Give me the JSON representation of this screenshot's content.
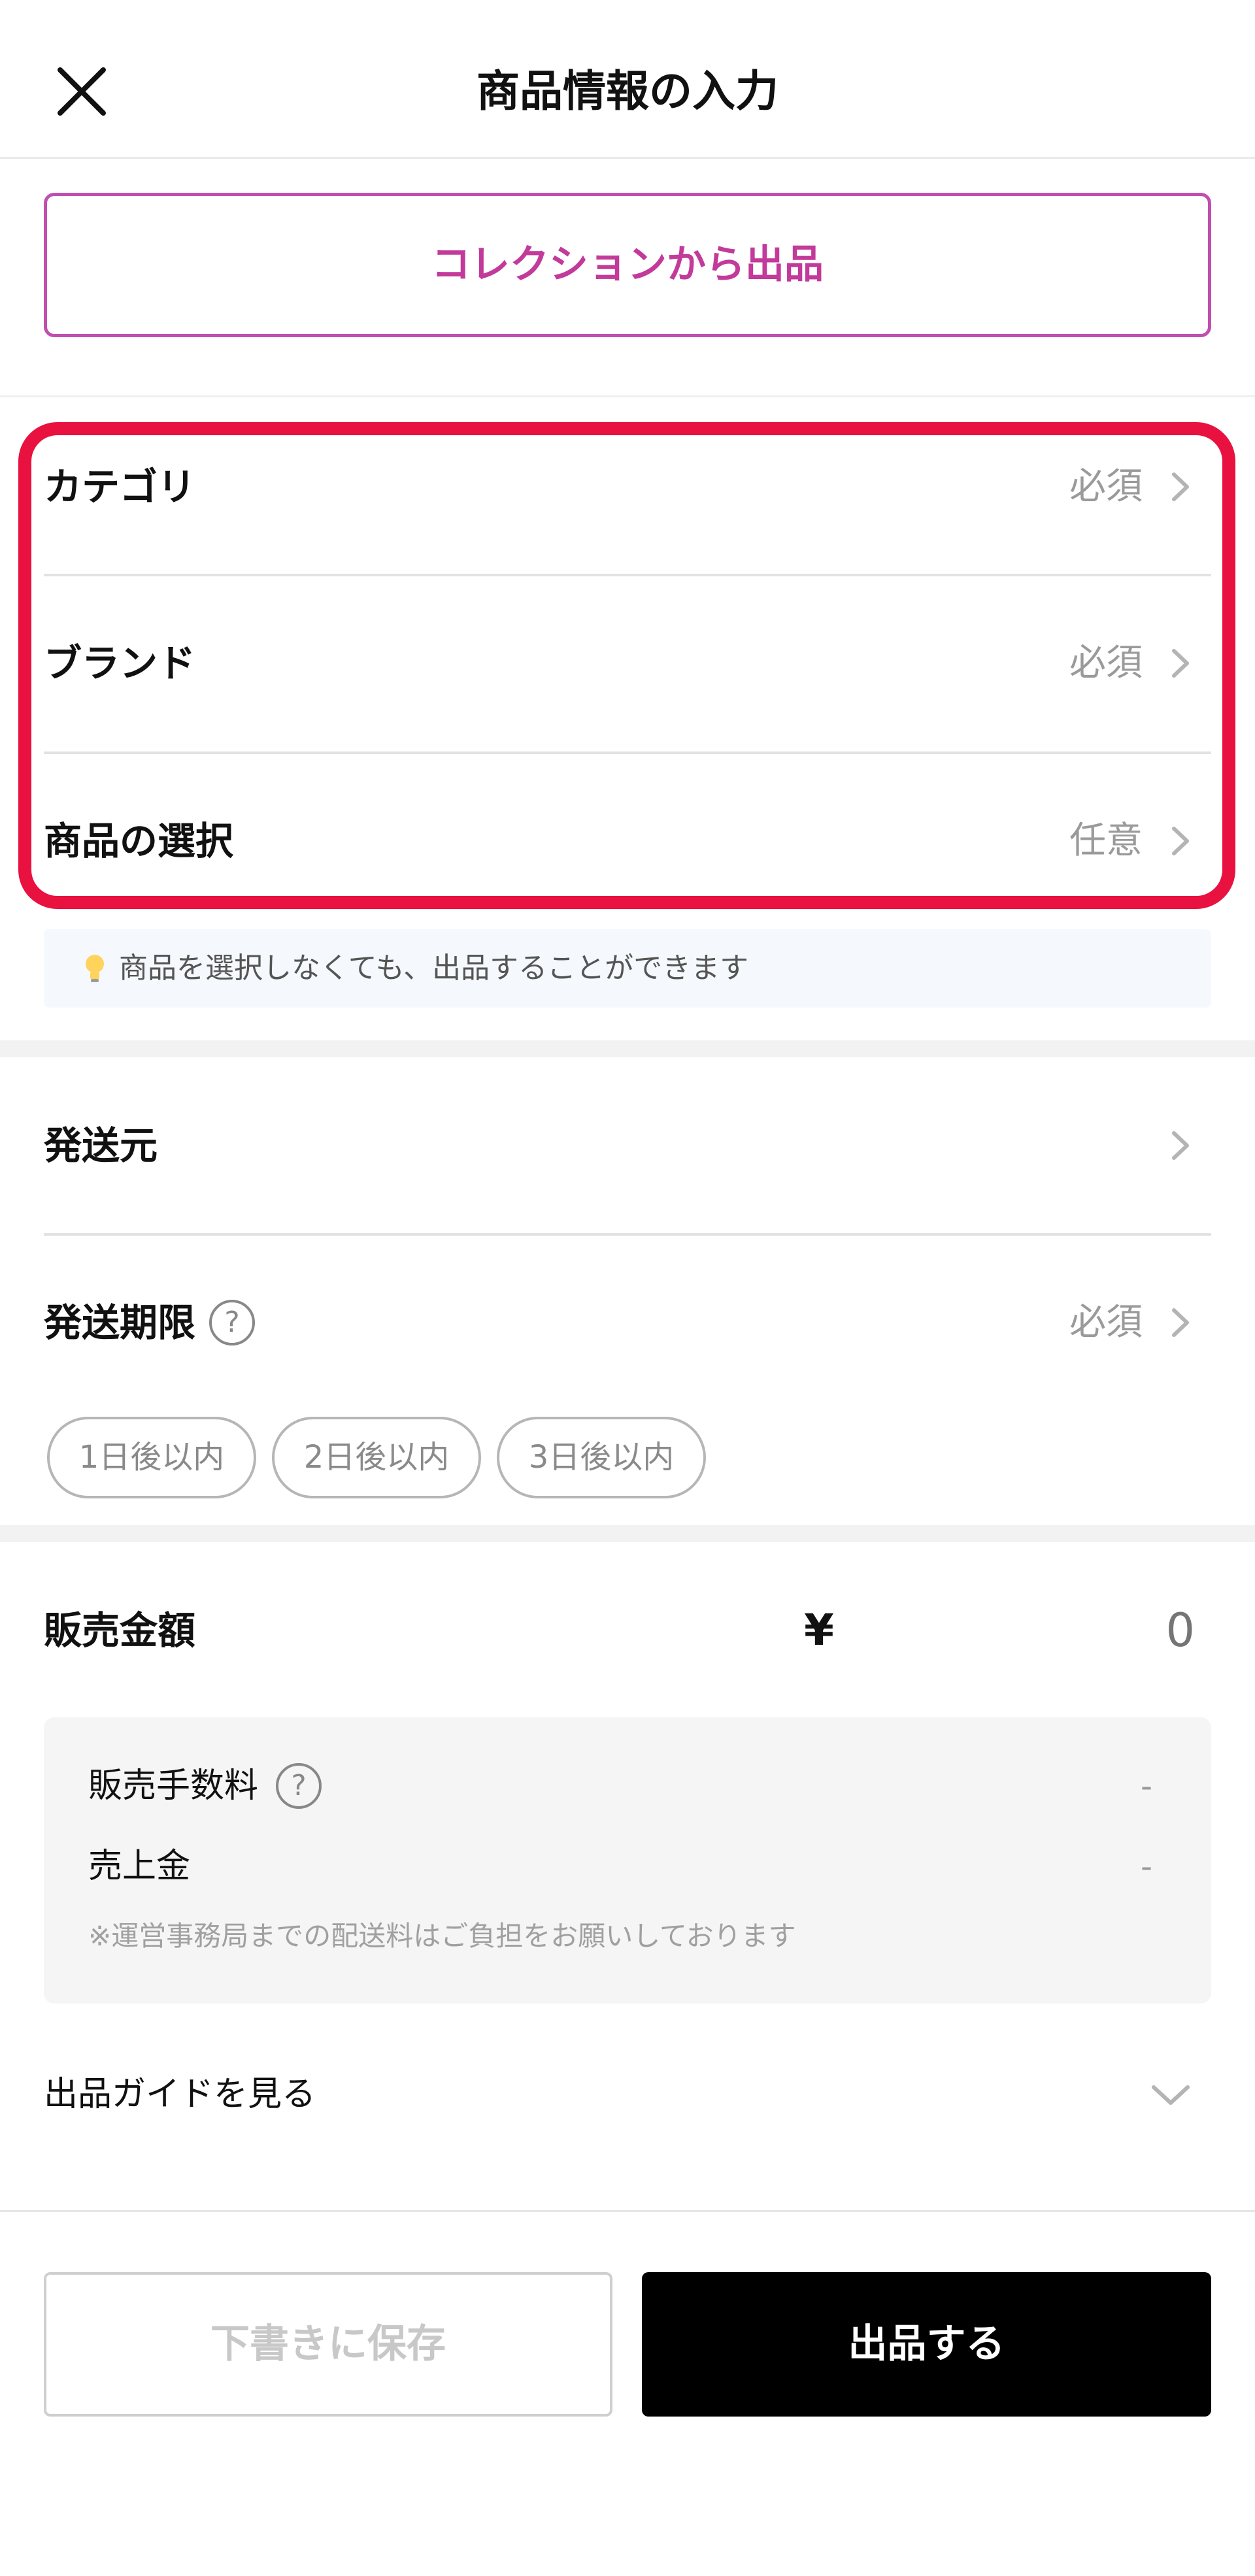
{
  "header": {
    "title": "商品情報の入力",
    "close_icon": "close-icon"
  },
  "collection_button": {
    "label": "コレクションから出品"
  },
  "product_fields": [
    {
      "label": "カテゴリ",
      "value": "必須"
    },
    {
      "label": "ブランド",
      "value": "必須"
    },
    {
      "label": "商品の選択",
      "value": "任意"
    }
  ],
  "hint": {
    "icon": "lightbulb-icon",
    "text": "商品を選択しなくても、出品することができます"
  },
  "shipping": {
    "origin_label": "発送元",
    "deadline_label": "発送期限",
    "deadline_value": "必須",
    "deadline_help_icon": "?",
    "deadline_options": [
      "1日後以内",
      "2日後以内",
      "3日後以内"
    ]
  },
  "price": {
    "label": "販売金額",
    "currency": "¥",
    "placeholder": "0",
    "fee_label": "販売手数料",
    "fee_help_icon": "?",
    "fee_value": "-",
    "sales_label": "売上金",
    "sales_value": "-",
    "note": "※運営事務局までの配送料はご負担をお願いしております"
  },
  "guide": {
    "label": "出品ガイドを見る"
  },
  "footer": {
    "draft_label": "下書きに保存",
    "submit_label": "出品する"
  },
  "colors": {
    "highlight": "#e8113f",
    "collection_border": "#c04fb0",
    "collection_text": "#c23a9a",
    "submit_bg": "#000000"
  }
}
